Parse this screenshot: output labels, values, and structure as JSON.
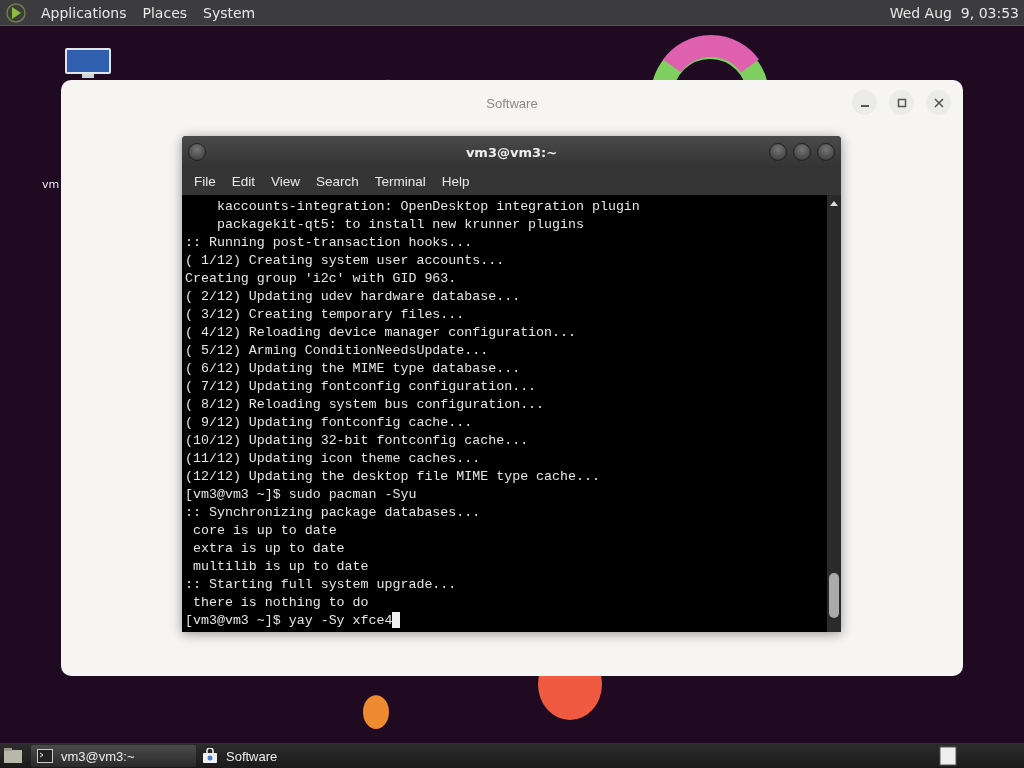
{
  "top_panel": {
    "menus": [
      "Applications",
      "Places",
      "System"
    ],
    "clock": "Wed Aug  9, 03:53"
  },
  "desktop": {
    "icons": [
      {
        "label": "vm"
      }
    ]
  },
  "software_window": {
    "title": "Software"
  },
  "terminal": {
    "title": "vm3@vm3:~",
    "menus": [
      "File",
      "Edit",
      "View",
      "Search",
      "Terminal",
      "Help"
    ],
    "cursor": true,
    "lines": [
      "    kaccounts-integration: OpenDesktop integration plugin",
      "    packagekit-qt5: to install new krunner plugins",
      ":: Running post-transaction hooks...",
      "( 1/12) Creating system user accounts...",
      "Creating group 'i2c' with GID 963.",
      "( 2/12) Updating udev hardware database...",
      "( 3/12) Creating temporary files...",
      "( 4/12) Reloading device manager configuration...",
      "( 5/12) Arming ConditionNeedsUpdate...",
      "( 6/12) Updating the MIME type database...",
      "( 7/12) Updating fontconfig configuration...",
      "( 8/12) Reloading system bus configuration...",
      "( 9/12) Updating fontconfig cache...",
      "(10/12) Updating 32-bit fontconfig cache...",
      "(11/12) Updating icon theme caches...",
      "(12/12) Updating the desktop file MIME type cache...",
      "[vm3@vm3 ~]$ sudo pacman -Syu",
      ":: Synchronizing package databases...",
      " core is up to date",
      " extra is up to date",
      " multilib is up to date",
      ":: Starting full system upgrade...",
      " there is nothing to do",
      "[vm3@vm3 ~]$ yay -Sy xfce4"
    ]
  },
  "taskbar": {
    "items": [
      {
        "kind": "terminal",
        "label": "vm3@vm3:~",
        "selected": true
      },
      {
        "kind": "software",
        "label": "Software",
        "selected": false
      }
    ]
  }
}
